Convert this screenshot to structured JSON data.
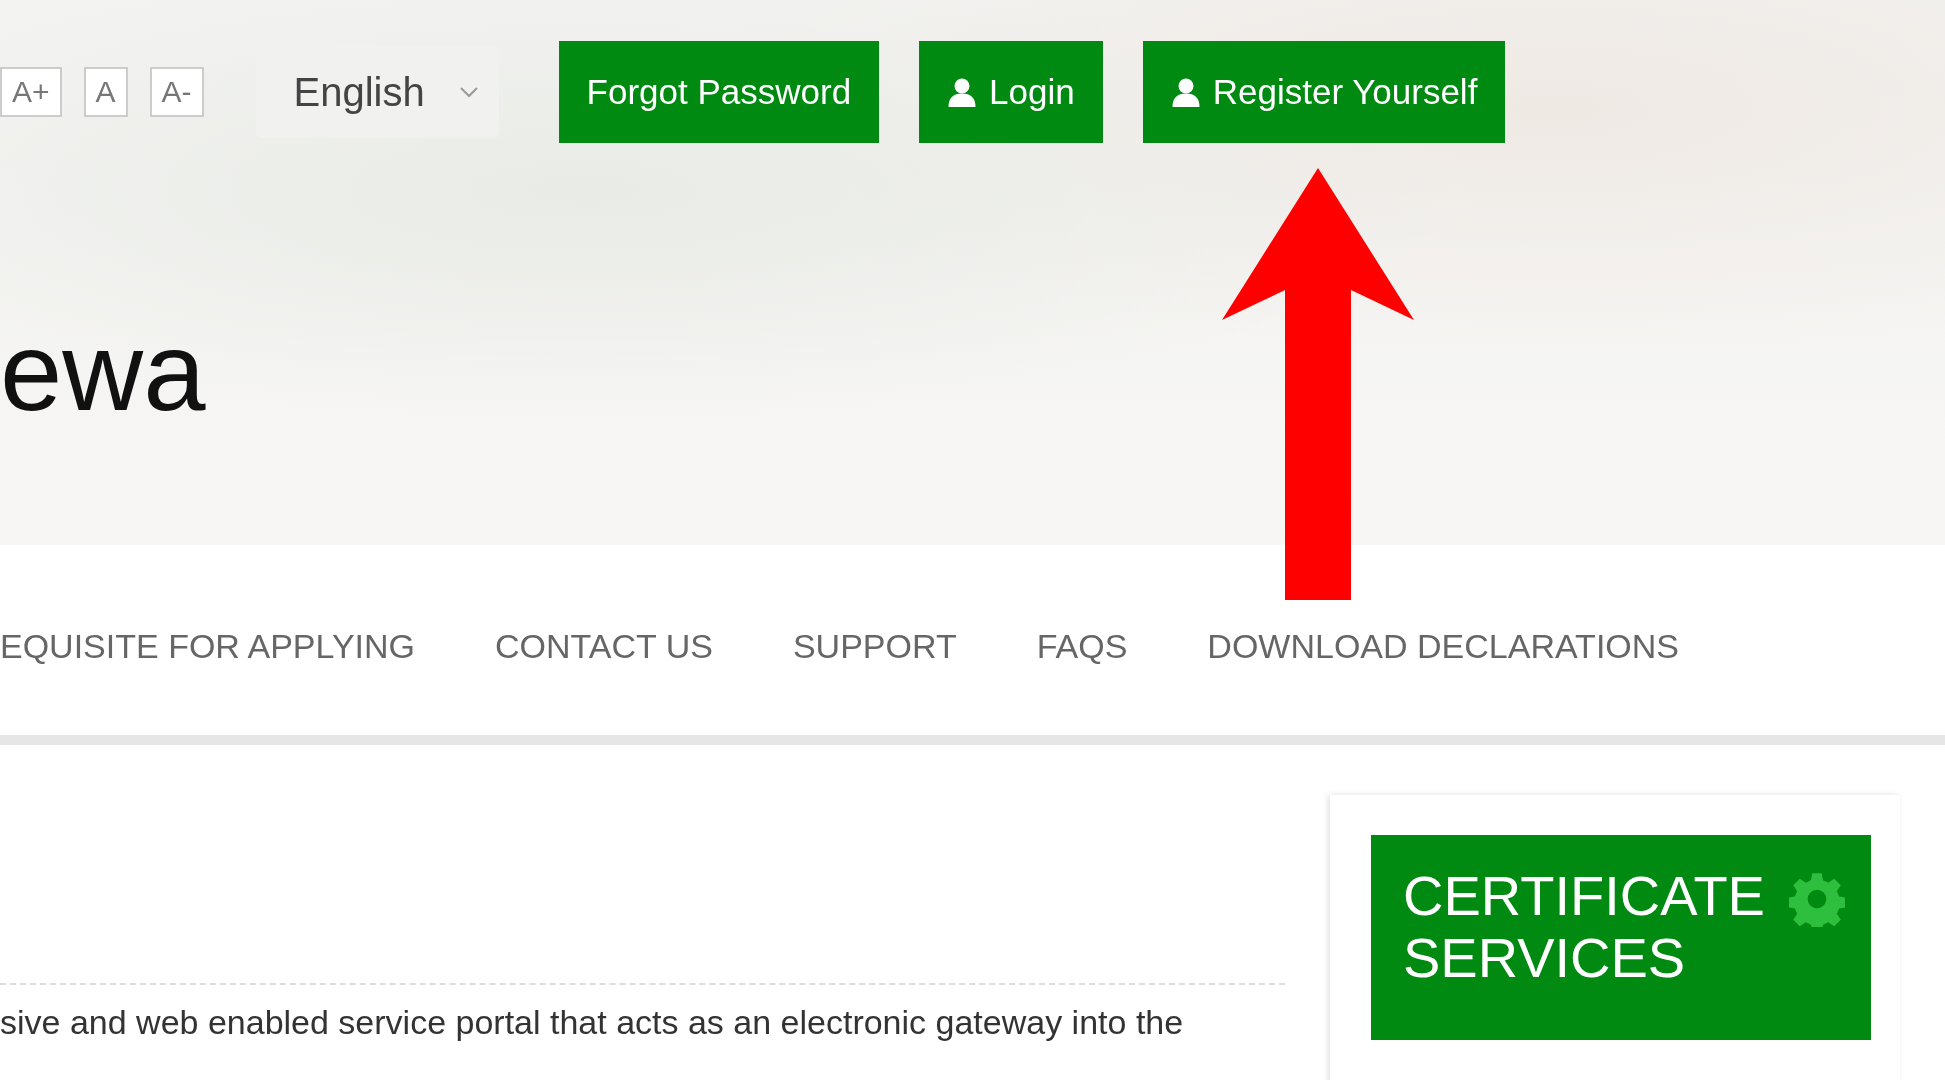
{
  "font_size_controls": [
    "A+",
    "A",
    "A-"
  ],
  "language_select": {
    "value": "English"
  },
  "header_buttons": [
    {
      "label": "Forgot Password",
      "kind": "plain"
    },
    {
      "label": "Login",
      "kind": "user"
    },
    {
      "label": "Register Yourself",
      "kind": "user"
    }
  ],
  "site_title": "ewa",
  "nav_items": [
    "EQUISITE FOR APPLYING",
    "CONTACT US",
    "SUPPORT",
    "FAQS",
    "DOWNLOAD DECLARATIONS"
  ],
  "sidebar": {
    "title_lines": [
      "CERTIFICATE",
      "SERVICES"
    ]
  },
  "intro_text": "sive and web enabled service portal that acts as an electronic gateway into the"
}
